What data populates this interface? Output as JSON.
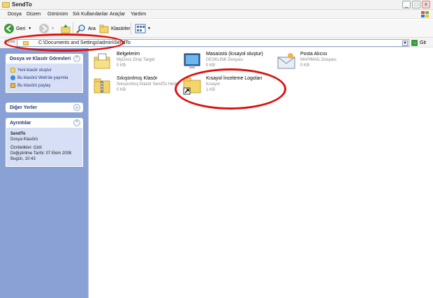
{
  "window": {
    "title": "SendTo",
    "buttons": {
      "minimize": "_",
      "maximize": "□",
      "close": "×"
    }
  },
  "menu": [
    "Dosya",
    "Düzen",
    "Görünüm",
    "Sık Kullanılanlar",
    "Araçlar",
    "Yardım"
  ],
  "toolbar": {
    "back_label": "Geri",
    "search_label": "Ara",
    "folders_label": "Klasörler"
  },
  "address": {
    "label": "Adres",
    "path": "C:\\Documents and Settings\\admin\\SendTo",
    "go_label": "Git"
  },
  "left_pane": {
    "tasks": {
      "title": "Dosya ve Klasör Görevleri",
      "items": [
        "Yeni klasör oluştur",
        "Bu klasörü Web'de yayımla",
        "Bu klasörü paylaş"
      ]
    },
    "other_places": {
      "title": "Diğer Yerler"
    },
    "details": {
      "title": "Ayrıntılar",
      "name": "SendTo",
      "type": "Dosya Klasörü",
      "attributes": "Öznitelikler: Gizli",
      "modified": "Değiştirilme Tarihi: 07 Ekim 2008",
      "today": "Bugün, 10:43"
    }
  },
  "files": [
    {
      "name": "Belgelerim",
      "type": "MyDocs Drop Target",
      "size": "0 KB",
      "icon": "my-documents-icon"
    },
    {
      "name": "Masaüstü (kısayol oluştur)",
      "type": "DESKLINK Dosyası",
      "size": "0 KB",
      "icon": "desktop-shortcut-icon"
    },
    {
      "name": "Posta Alıcısı",
      "type": "MAPIMAIL Dosyası",
      "size": "0 KB",
      "icon": "mail-recipient-icon"
    },
    {
      "name": "Sıkıştırılmış Klasör",
      "type": "Sıkıştırılmış Klasör SendTo Hedef",
      "size": "0 KB",
      "icon": "zip-folder-icon"
    },
    {
      "name": "Kısayol İnceleme Logoları",
      "type": "Kısayol",
      "size": "1 KB",
      "icon": "folder-shortcut-icon"
    }
  ],
  "colors": {
    "annotation": "#dd1111",
    "left_pane": "#8aa1d6"
  }
}
